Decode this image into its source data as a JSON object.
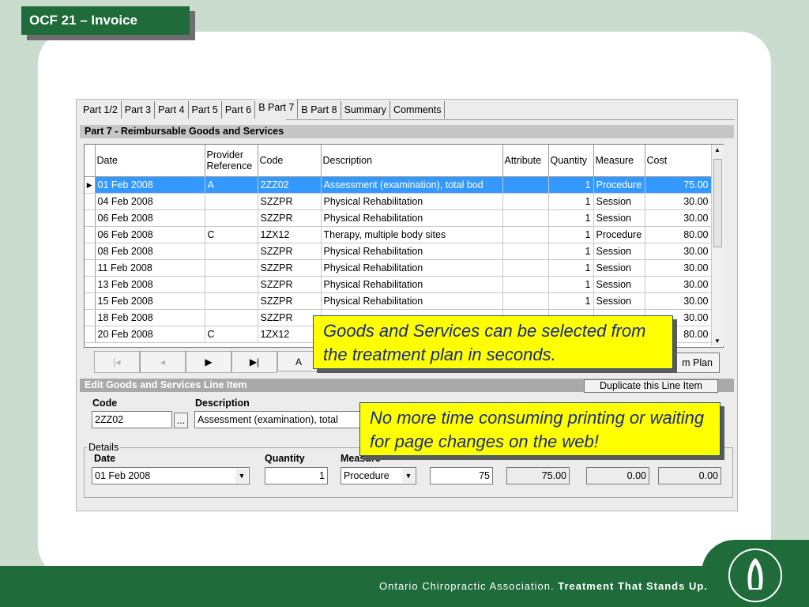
{
  "slide_title": "OCF 21 – Invoice",
  "tabs": [
    "Part 1/2",
    "Part 3",
    "Part 4",
    "Part 5",
    "Part 6",
    "B Part 7",
    "B Part 8",
    "Summary",
    "Comments"
  ],
  "active_tab": "B Part 7",
  "section_title": "Part 7 - Reimbursable Goods and Services",
  "grid": {
    "headers": {
      "date": "Date",
      "provider_reference": "Provider Reference",
      "code": "Code",
      "description": "Description",
      "attribute": "Attribute",
      "quantity": "Quantity",
      "measure": "Measure",
      "cost": "Cost"
    },
    "current_row_marker": "▶",
    "rows": [
      {
        "date": "01 Feb 2008",
        "ref": "A",
        "code": "2ZZ02",
        "description": "Assessment (examination), total bod",
        "attribute": "",
        "quantity": "1",
        "measure": "Procedure",
        "cost": "75.00"
      },
      {
        "date": "04 Feb 2008",
        "ref": "",
        "code": "SZZPR",
        "description": "Physical Rehabilitation",
        "attribute": "",
        "quantity": "1",
        "measure": "Session",
        "cost": "30.00"
      },
      {
        "date": "06 Feb 2008",
        "ref": "",
        "code": "SZZPR",
        "description": "Physical Rehabilitation",
        "attribute": "",
        "quantity": "1",
        "measure": "Session",
        "cost": "30.00"
      },
      {
        "date": "06 Feb 2008",
        "ref": "C",
        "code": "1ZX12",
        "description": "Therapy, multiple body sites",
        "attribute": "",
        "quantity": "1",
        "measure": "Procedure",
        "cost": "80.00"
      },
      {
        "date": "08 Feb 2008",
        "ref": "",
        "code": "SZZPR",
        "description": "Physical Rehabilitation",
        "attribute": "",
        "quantity": "1",
        "measure": "Session",
        "cost": "30.00"
      },
      {
        "date": "11 Feb 2008",
        "ref": "",
        "code": "SZZPR",
        "description": "Physical Rehabilitation",
        "attribute": "",
        "quantity": "1",
        "measure": "Session",
        "cost": "30.00"
      },
      {
        "date": "13 Feb 2008",
        "ref": "",
        "code": "SZZPR",
        "description": "Physical Rehabilitation",
        "attribute": "",
        "quantity": "1",
        "measure": "Session",
        "cost": "30.00"
      },
      {
        "date": "15 Feb 2008",
        "ref": "",
        "code": "SZZPR",
        "description": "Physical Rehabilitation",
        "attribute": "",
        "quantity": "1",
        "measure": "Session",
        "cost": "30.00"
      },
      {
        "date": "18 Feb 2008",
        "ref": "",
        "code": "SZZPR",
        "description": "",
        "attribute": "",
        "quantity": "",
        "measure": "",
        "cost": "30.00"
      },
      {
        "date": "20 Feb 2008",
        "ref": "C",
        "code": "1ZX12",
        "description": "",
        "attribute": "",
        "quantity": "",
        "measure": "",
        "cost": "80.00"
      }
    ]
  },
  "navigation": {
    "first": "|◂",
    "prev": "◂",
    "next": "▶",
    "last": "▶|",
    "add_partial": "A",
    "from_plan_partial": "m Plan"
  },
  "edit_section": {
    "title": "Edit Goods and Services Line Item",
    "duplicate_button": "Duplicate this Line Item",
    "code_label": "Code",
    "code_value": "2ZZ02",
    "lookup_button": "...",
    "description_label": "Description",
    "description_value": "Assessment (examination), total",
    "details_legend": "Details",
    "date_label": "Date",
    "date_value": "01 Feb 2008",
    "quantity_label": "Quantity",
    "quantity_value": "1",
    "measure_label": "Measure",
    "measure_value": "Procedure",
    "unit_cost_value": "75",
    "cost_value": "75.00",
    "pst_value": "0.00",
    "gst_value": "0.00"
  },
  "callouts": {
    "goods": "Goods and Services can be selected from the treatment plan in seconds.",
    "printing": "No more time consuming printing or waiting for page changes on the web!"
  },
  "footer": {
    "association": "Ontario Chiropractic Association.",
    "tagline": "Treatment That Stands Up."
  },
  "colors": {
    "brand_green": "#1f6b3a",
    "selection_blue": "#3399ff",
    "callout_yellow": "#ffff00"
  }
}
